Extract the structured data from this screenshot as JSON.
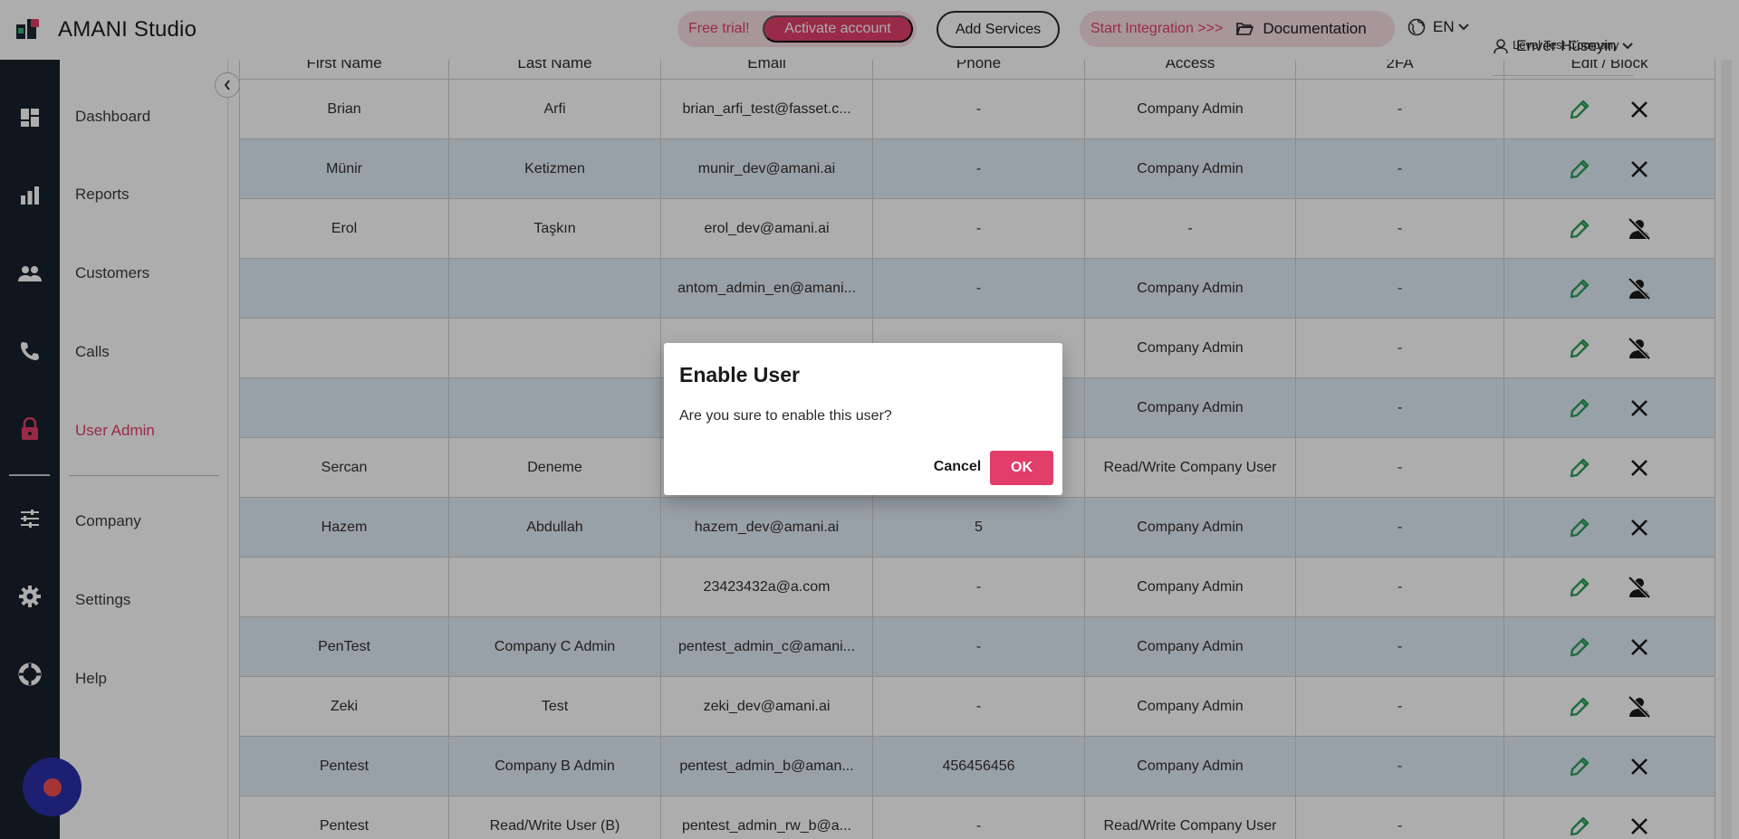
{
  "app": {
    "title": "AMANI Studio"
  },
  "header": {
    "free_trial": "Free trial!",
    "activate": "Activate account",
    "add_services": "Add Services",
    "start_integration": "Start Integration >>>",
    "documentation": "Documentation",
    "language": "EN",
    "user_name": "Enver Hüseyin",
    "company": "Level Test Company"
  },
  "sidebar": {
    "items": [
      {
        "label": "Dashboard",
        "icon": "dashboard-icon"
      },
      {
        "label": "Reports",
        "icon": "bar-chart-icon"
      },
      {
        "label": "Customers",
        "icon": "people-icon"
      },
      {
        "label": "Calls",
        "icon": "phone-icon"
      },
      {
        "label": "User Admin",
        "icon": "lock-icon",
        "active": true
      },
      {
        "label": "Company",
        "icon": "sliders-icon"
      },
      {
        "label": "Settings",
        "icon": "gear-icon"
      },
      {
        "label": "Help",
        "icon": "lifebuoy-icon"
      }
    ]
  },
  "table": {
    "columns": [
      "First Name",
      "Last Name",
      "Email",
      "Phone",
      "Access",
      "2FA",
      "Edit / Block"
    ],
    "rows": [
      {
        "first": "Brian",
        "last": "Arfi",
        "email": "brian_arfi_test@fasset.c...",
        "phone": "-",
        "access": "Company Admin",
        "twofa": "-",
        "blocked": false
      },
      {
        "first": "Münir",
        "last": "Ketizmen",
        "email": "munir_dev@amani.ai",
        "phone": "-",
        "access": "Company Admin",
        "twofa": "-",
        "blocked": false
      },
      {
        "first": "Erol",
        "last": "Taşkın",
        "email": "erol_dev@amani.ai",
        "phone": "-",
        "access": "-",
        "twofa": "-",
        "blocked": true
      },
      {
        "first": "",
        "last": "",
        "email": "antom_admin_en@amani...",
        "phone": "-",
        "access": "Company Admin",
        "twofa": "-",
        "blocked": true
      },
      {
        "first": "",
        "last": "",
        "email": "",
        "phone": "",
        "access": "Company Admin",
        "twofa": "-",
        "blocked": true
      },
      {
        "first": "",
        "last": "",
        "email": "",
        "phone": "",
        "access": "Company Admin",
        "twofa": "-",
        "blocked": false
      },
      {
        "first": "Sercan",
        "last": "Deneme",
        "email": "",
        "phone": "",
        "access": "Read/Write Company User",
        "twofa": "-",
        "blocked": false
      },
      {
        "first": "Hazem",
        "last": "Abdullah",
        "email": "hazem_dev@amani.ai",
        "phone": "5",
        "access": "Company Admin",
        "twofa": "-",
        "blocked": false
      },
      {
        "first": "",
        "last": "",
        "email": "23423432a@a.com",
        "phone": "-",
        "access": "Company Admin",
        "twofa": "-",
        "blocked": true
      },
      {
        "first": "PenTest",
        "last": "Company C Admin",
        "email": "pentest_admin_c@amani...",
        "phone": "-",
        "access": "Company Admin",
        "twofa": "-",
        "blocked": false
      },
      {
        "first": "Zeki",
        "last": "Test",
        "email": "zeki_dev@amani.ai",
        "phone": "-",
        "access": "Company Admin",
        "twofa": "-",
        "blocked": true
      },
      {
        "first": "Pentest",
        "last": "Company B Admin",
        "email": "pentest_admin_b@aman...",
        "phone": "456456456",
        "access": "Company Admin",
        "twofa": "-",
        "blocked": false
      },
      {
        "first": "Pentest",
        "last": "Read/Write User (B)",
        "email": "pentest_admin_rw_b@a...",
        "phone": "-",
        "access": "Read/Write Company User",
        "twofa": "-",
        "blocked": false
      }
    ]
  },
  "dialog": {
    "title": "Enable User",
    "message": "Are you sure to enable this user?",
    "cancel": "Cancel",
    "ok": "OK"
  },
  "colors": {
    "accent": "#e23e6a",
    "rail": "#19212c",
    "edit": "#2e9e5b"
  }
}
